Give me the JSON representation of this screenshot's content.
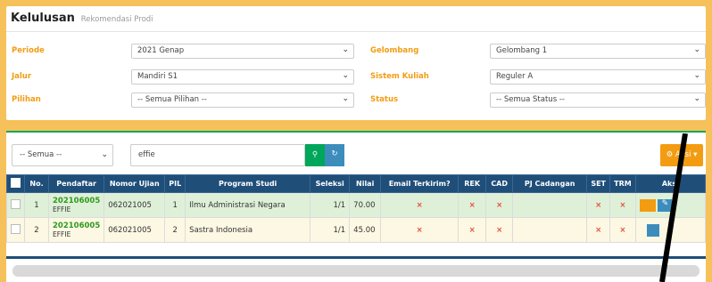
{
  "header": {
    "title": "Kelulusan",
    "subtitle": "Rekomendasi Prodi"
  },
  "filters": {
    "periode": {
      "label": "Periode",
      "value": "2021 Genap"
    },
    "gelombang": {
      "label": "Gelombang",
      "value": "Gelombang 1"
    },
    "jalur": {
      "label": "Jalur",
      "value": "Mandiri S1"
    },
    "sistem_kuliah": {
      "label": "Sistem Kuliah",
      "value": "Reguler A"
    },
    "pilihan": {
      "label": "Pilihan",
      "value": "-- Semua Pilihan --"
    },
    "status": {
      "label": "Status",
      "value": "-- Semua Status --"
    }
  },
  "toolbar": {
    "scope_value": "-- Semua --",
    "search_value": "effie",
    "search_button": "Q",
    "refresh_icon": "refresh-icon",
    "aksi_label": "Aksi"
  },
  "table": {
    "columns": [
      "No.",
      "Pendaftar",
      "Nomor Ujian",
      "PIL",
      "Program Studi",
      "Seleksi",
      "Nilai",
      "Email Terkirim?",
      "REK",
      "CAD",
      "PJ Cadangan",
      "SET",
      "TRM",
      "Aksi"
    ],
    "rows": [
      {
        "no": "1",
        "id": "202106005",
        "name": "EFFIE",
        "nomor_ujian": "062021005",
        "pil": "1",
        "prodi": "Ilmu Administrasi Negara",
        "seleksi": "1/1",
        "nilai": "70.00"
      },
      {
        "no": "2",
        "id": "202106005",
        "name": "EFFIE",
        "nomor_ujian": "062021005",
        "pil": "2",
        "prodi": "Sastra Indonesia",
        "seleksi": "1/1",
        "nilai": "45.00"
      }
    ],
    "x_mark": "×"
  },
  "colors": {
    "accent": "#f39c12",
    "header": "#1f4e79",
    "success": "#00a65a",
    "primary": "#3c8dbc"
  }
}
